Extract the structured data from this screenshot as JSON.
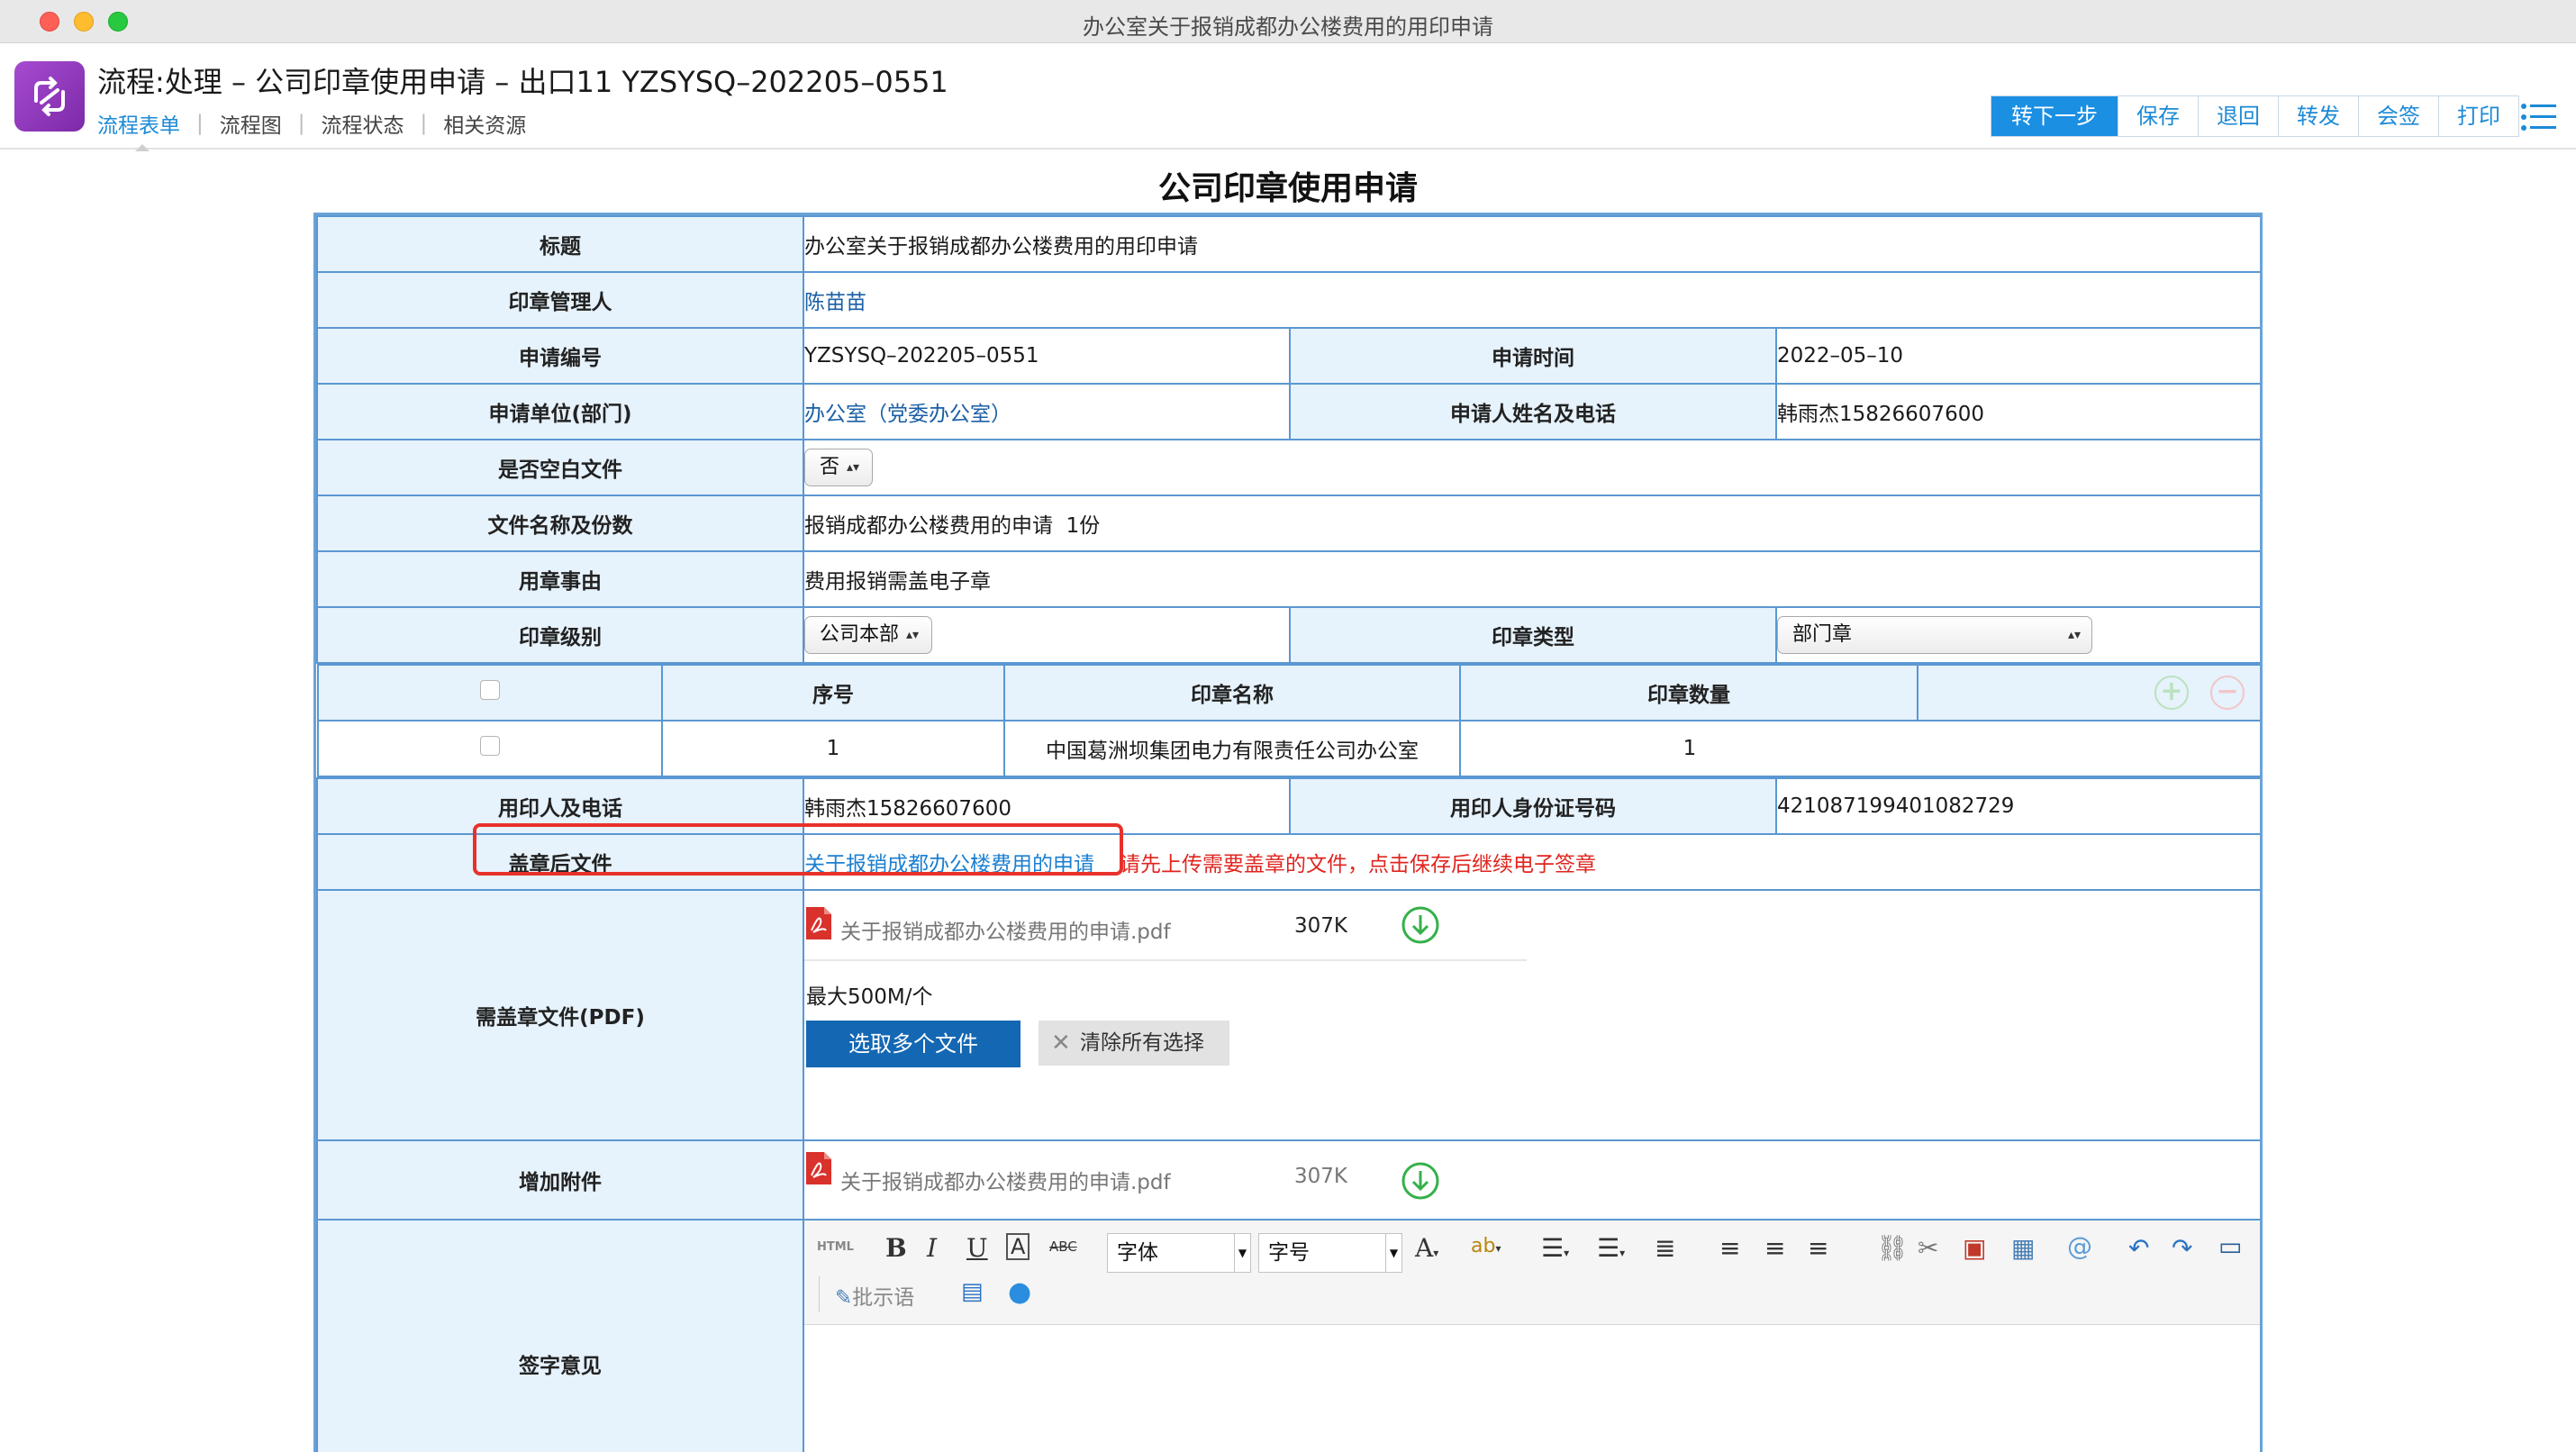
{
  "window": {
    "title": "办公室关于报销成都办公楼费用的用印申请"
  },
  "header": {
    "process_title": "流程:处理 – 公司印章使用申请 – 出口11 YZSYSQ–202205–0551",
    "tabs": [
      {
        "label": "流程表单",
        "active": true
      },
      {
        "label": "流程图"
      },
      {
        "label": "流程状态"
      },
      {
        "label": "相关资源"
      }
    ],
    "toolbar": [
      "转下一步",
      "保存",
      "退回",
      "转发",
      "会签",
      "打印"
    ]
  },
  "form": {
    "title": "公司印章使用申请",
    "labels": {
      "title": "标题",
      "seal_manager": "印章管理人",
      "apply_no": "申请编号",
      "apply_time": "申请时间",
      "apply_unit": "申请单位(部门)",
      "applicant": "申请人姓名及电话",
      "blank_doc": "是否空白文件",
      "doc_name": "文件名称及份数",
      "reason": "用章事由",
      "seal_level": "印章级别",
      "seal_type": "印章类型",
      "user": "用印人及电话",
      "id_no": "用印人身份证号码",
      "sealed_file": "盖章后文件",
      "pdf": "需盖章文件(PDF)",
      "attachment": "增加附件",
      "opinion": "签字意见"
    },
    "values": {
      "title": "办公室关于报销成都办公楼费用的用印申请",
      "seal_manager": "陈苗苗",
      "apply_no": "YZSYSQ–202205–0551",
      "apply_time": "2022–05–10",
      "apply_unit": "办公室（党委办公室）",
      "applicant": "韩雨杰15826607600",
      "blank_doc": "否",
      "doc_name": "报销成都办公楼费用的申请  1份",
      "reason": "费用报销需盖电子章",
      "seal_level": "公司本部",
      "seal_type": "部门章",
      "user": "韩雨杰15826607600",
      "id_no": "421087199401082729",
      "sealed_file_link": "关于报销成都办公楼费用的申请",
      "sealed_file_hint": "请先上传需要盖章的文件，点击保存后继续电子签章"
    },
    "seal_table": {
      "headers": [
        "序号",
        "印章名称",
        "印章数量"
      ],
      "rows": [
        {
          "no": "1",
          "name": "中国葛洲坝集团电力有限责任公司办公室",
          "qty": "1"
        }
      ]
    },
    "pdf_section": {
      "file_name": "关于报销成都办公楼费用的申请.pdf",
      "file_size": "307K",
      "max_note": "最大500M/个",
      "upload_label": "选取多个文件",
      "clear_label": "清除所有选择"
    },
    "attachment_section": {
      "file_name": "关于报销成都办公楼费用的申请.pdf",
      "file_size": "307K"
    },
    "editor": {
      "html_label": "HTML",
      "font_label": "字体",
      "size_label": "字号",
      "comment_label": "批示语"
    }
  },
  "colors": {
    "accent": "#1b8fe2",
    "label_bg": "#e6f2fc",
    "border": "#5b97d2",
    "hint": "#e0251f",
    "link": "#1a5fa6",
    "logo": "#8e35bf"
  }
}
